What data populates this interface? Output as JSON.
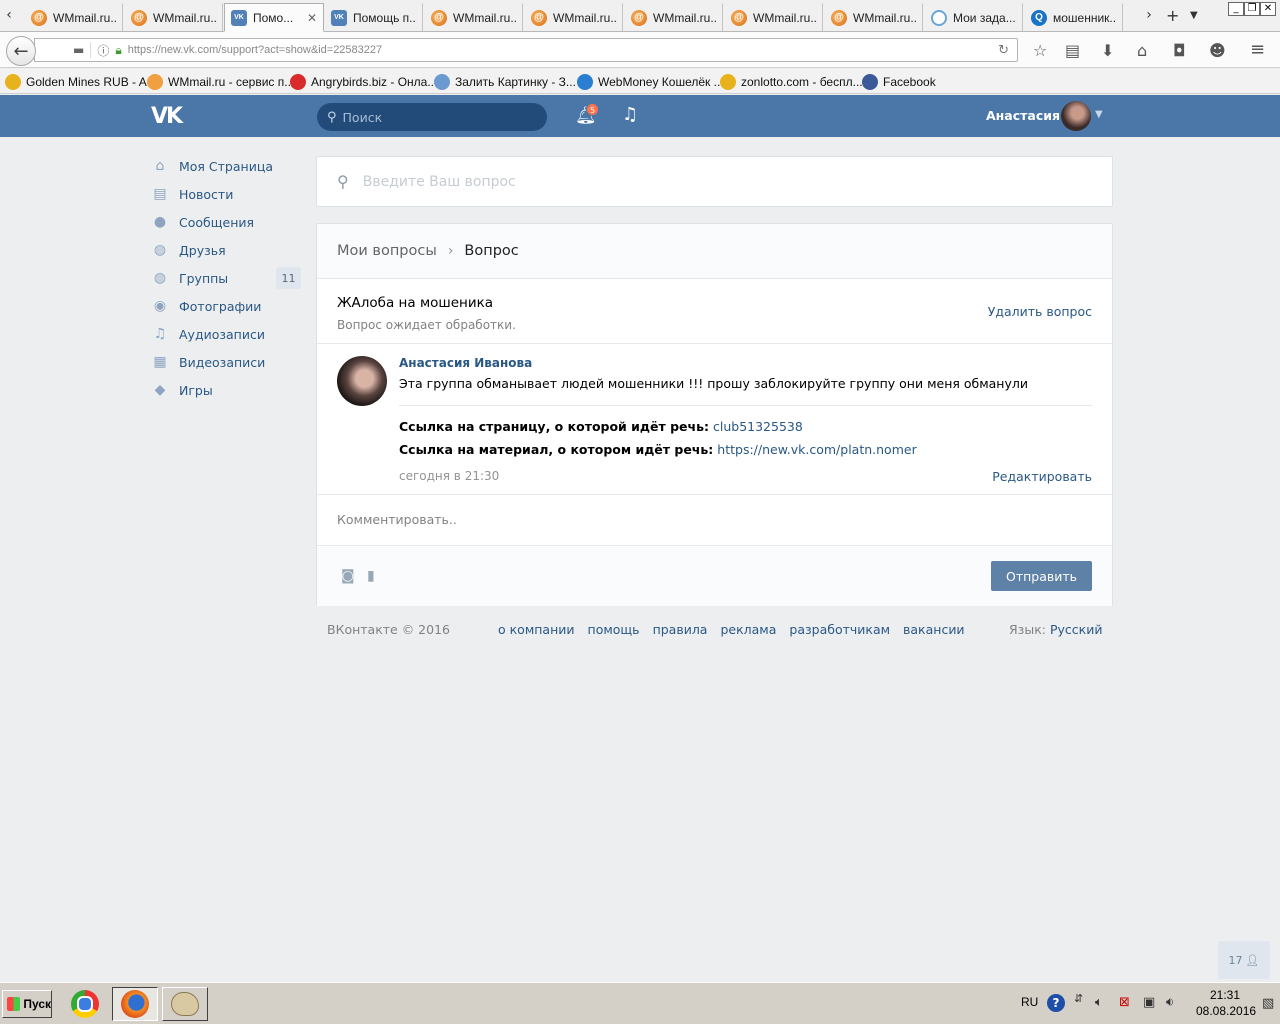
{
  "browser": {
    "tabs": [
      {
        "label": "WMmail.ru...",
        "icon": "wmmail-favicon",
        "active": false
      },
      {
        "label": "WMmail.ru...",
        "icon": "wmmail-favicon",
        "active": false
      },
      {
        "label": "Помо...",
        "icon": "vk-favicon",
        "active": true
      },
      {
        "label": "Помощь п...",
        "icon": "vk-favicon",
        "active": false
      },
      {
        "label": "WMmail.ru...",
        "icon": "wmmail-favicon",
        "active": false
      },
      {
        "label": "WMmail.ru...",
        "icon": "wmmail-favicon",
        "active": false
      },
      {
        "label": "WMmail.ru...",
        "icon": "wmmail-favicon",
        "active": false
      },
      {
        "label": "WMmail.ru...",
        "icon": "wmmail-favicon",
        "active": false
      },
      {
        "label": "WMmail.ru...",
        "icon": "wmmail-favicon",
        "active": false
      },
      {
        "label": "Мои зада...",
        "icon": "tasks-favicon",
        "active": false
      },
      {
        "label": "мошенник...",
        "icon": "search-favicon",
        "active": false
      }
    ],
    "url": "https://new.vk.com/support?act=show&id=22583227",
    "bookmarks": [
      {
        "label": "Golden Mines RUB - A...",
        "color": "#e8b21c"
      },
      {
        "label": "WMmail.ru - сервис п...",
        "color": "#f0a040"
      },
      {
        "label": "Angrybirds.biz - Онла...",
        "color": "#d92b2b"
      },
      {
        "label": "Залить Картинку - З...",
        "color": "#6a9ad0"
      },
      {
        "label": "WebMoney Кошелёк ...",
        "color": "#2a7fd0"
      },
      {
        "label": "zonlotto.com - беспл...",
        "color": "#e8b21c"
      },
      {
        "label": "Facebook",
        "color": "#3b5998"
      }
    ]
  },
  "vk": {
    "header": {
      "logo": "VK",
      "search_placeholder": "Поиск",
      "notifications_count": "5",
      "user_name": "Анастасия"
    },
    "menu": [
      {
        "label": "Моя Страница",
        "icon": "home-icon",
        "glyph": "⌂"
      },
      {
        "label": "Новости",
        "icon": "news-icon",
        "glyph": "▤"
      },
      {
        "label": "Сообщения",
        "icon": "messages-icon",
        "glyph": "●"
      },
      {
        "label": "Друзья",
        "icon": "friends-icon",
        "glyph": "◍"
      },
      {
        "label": "Группы",
        "icon": "groups-icon",
        "glyph": "◍",
        "count": "11"
      },
      {
        "label": "Фотографии",
        "icon": "camera-icon",
        "glyph": "◉"
      },
      {
        "label": "Аудиозаписи",
        "icon": "music-icon",
        "glyph": "♫"
      },
      {
        "label": "Видеозаписи",
        "icon": "video-icon",
        "glyph": "▦"
      },
      {
        "label": "Игры",
        "icon": "gamepad-icon",
        "glyph": "◆"
      }
    ],
    "question_search_placeholder": "Введите Ваш вопрос",
    "breadcrumb": {
      "parent": "Мои вопросы",
      "current": "Вопрос"
    },
    "question": {
      "title": "ЖАлоба на мошеника",
      "status": "Вопрос ожидает обработки.",
      "delete_label": "Удалить вопрос"
    },
    "post": {
      "author": "Анастасия Иванова",
      "text": "Эта группа обманывает людей мошенники !!! прошу заблокируйте группу они меня обманули",
      "page_link_label": "Ссылка на страницу, о которой идёт речь:",
      "page_link_value": "club51325538",
      "material_link_label": "Ссылка на материал, о котором идёт речь:",
      "material_link_value": "https://new.vk.com/platn.nomer",
      "time": "сегодня в 21:30",
      "edit_label": "Редактировать"
    },
    "comment": {
      "placeholder": "Комментировать..",
      "send_label": "Отправить"
    },
    "footer": {
      "copyright": "ВКонтакте © 2016",
      "links": [
        "о компании",
        "помощь",
        "правила",
        "реклама",
        "разработчикам",
        "вакансии"
      ],
      "lang_label": "Язык:",
      "lang_value": "Русский"
    },
    "online_count": "17"
  },
  "taskbar": {
    "start_label": "Пуск",
    "lang": "RU",
    "time": "21:31",
    "date": "08.08.2016"
  }
}
